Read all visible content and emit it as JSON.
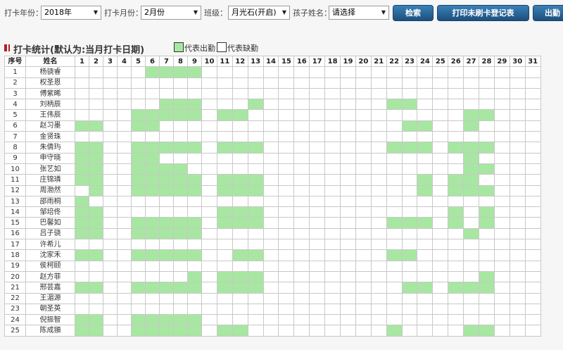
{
  "filters": {
    "year_label": "打卡年份：",
    "year_value": "2018年",
    "month_label": "打卡月份：",
    "month_value": "2月份",
    "class_label": "班级：",
    "class_value": "月光石(开启)",
    "child_label": "孩子姓名：",
    "child_value": "请选择"
  },
  "buttons": {
    "search": "检索",
    "print": "打印未刷卡登记表",
    "export": "出勤"
  },
  "section": {
    "title": "打卡统计(默认为:当月打卡日期)",
    "legend_present": "代表出勤",
    "legend_absent": "代表缺勤"
  },
  "colors": {
    "present": "#a7e7a2",
    "button": "#1f5a8c",
    "marker": "#b02020"
  },
  "table": {
    "headers": {
      "index": "序号",
      "name": "姓名"
    },
    "days": [
      1,
      2,
      3,
      4,
      5,
      6,
      7,
      8,
      9,
      10,
      11,
      12,
      13,
      14,
      15,
      16,
      17,
      18,
      19,
      20,
      21,
      22,
      23,
      24,
      25,
      26,
      27,
      28,
      29,
      30,
      31
    ],
    "rows": [
      {
        "no": "1",
        "name": "杨骁睿",
        "present": [
          6,
          7,
          8,
          9
        ]
      },
      {
        "no": "2",
        "name": "权圣恩",
        "present": []
      },
      {
        "no": "3",
        "name": "傅紫晞",
        "present": []
      },
      {
        "no": "4",
        "name": "刘柄辰",
        "present": [
          7,
          8,
          9,
          13,
          22,
          23
        ]
      },
      {
        "no": "5",
        "name": "王伟辰",
        "present": [
          5,
          6,
          7,
          8,
          9,
          11,
          12,
          27,
          28
        ]
      },
      {
        "no": "6",
        "name": "赵习墨",
        "present": [
          1,
          2,
          5,
          6,
          23,
          24,
          27
        ]
      },
      {
        "no": "7",
        "name": "金贤珠",
        "present": []
      },
      {
        "no": "8",
        "name": "朱倩玙",
        "present": [
          1,
          2,
          5,
          6,
          7,
          8,
          9,
          11,
          12,
          13,
          22,
          23,
          24,
          26,
          27,
          28
        ]
      },
      {
        "no": "9",
        "name": "申守晓",
        "present": [
          1,
          2,
          5,
          6,
          27
        ]
      },
      {
        "no": "10",
        "name": "张艺如",
        "present": [
          1,
          2,
          5,
          6,
          7,
          8,
          27,
          28
        ]
      },
      {
        "no": "11",
        "name": "庄锦璘",
        "present": [
          1,
          2,
          5,
          6,
          7,
          8,
          9,
          11,
          12,
          13,
          24,
          26,
          27
        ]
      },
      {
        "no": "12",
        "name": "周渤然",
        "present": [
          2,
          5,
          6,
          7,
          8,
          9,
          11,
          12,
          13,
          24,
          26,
          27,
          28
        ]
      },
      {
        "no": "13",
        "name": "邵雨桐",
        "present": [
          1
        ]
      },
      {
        "no": "14",
        "name": "邹培佟",
        "present": [
          1,
          2,
          11,
          12,
          13,
          26,
          28
        ]
      },
      {
        "no": "15",
        "name": "巴馨如",
        "present": [
          1,
          2,
          5,
          6,
          7,
          8,
          9,
          11,
          12,
          13,
          22,
          23,
          24,
          26,
          28
        ]
      },
      {
        "no": "16",
        "name": "吕子骁",
        "present": [
          1,
          2,
          5,
          6,
          7,
          8,
          9,
          27
        ]
      },
      {
        "no": "17",
        "name": "许希儿",
        "present": []
      },
      {
        "no": "18",
        "name": "沈家禾",
        "present": [
          1,
          2,
          5,
          6,
          7,
          8,
          9,
          12,
          13,
          22,
          23
        ]
      },
      {
        "no": "19",
        "name": "侯柯颐",
        "present": []
      },
      {
        "no": "20",
        "name": "赵方菲",
        "present": [
          9,
          11,
          12,
          13,
          28
        ]
      },
      {
        "no": "21",
        "name": "邢芸嘉",
        "present": [
          1,
          2,
          5,
          6,
          7,
          8,
          9,
          11,
          12,
          13,
          23,
          24,
          26,
          27,
          28
        ]
      },
      {
        "no": "22",
        "name": "王湄源",
        "present": []
      },
      {
        "no": "23",
        "name": "朝圣英",
        "present": []
      },
      {
        "no": "24",
        "name": "倪振智",
        "present": [
          1,
          2,
          5,
          6,
          7,
          8,
          9
        ]
      },
      {
        "no": "25",
        "name": "陈成頨",
        "present": [
          1,
          2,
          5,
          6,
          7,
          8,
          9,
          11,
          12,
          22,
          27,
          28
        ]
      }
    ]
  }
}
